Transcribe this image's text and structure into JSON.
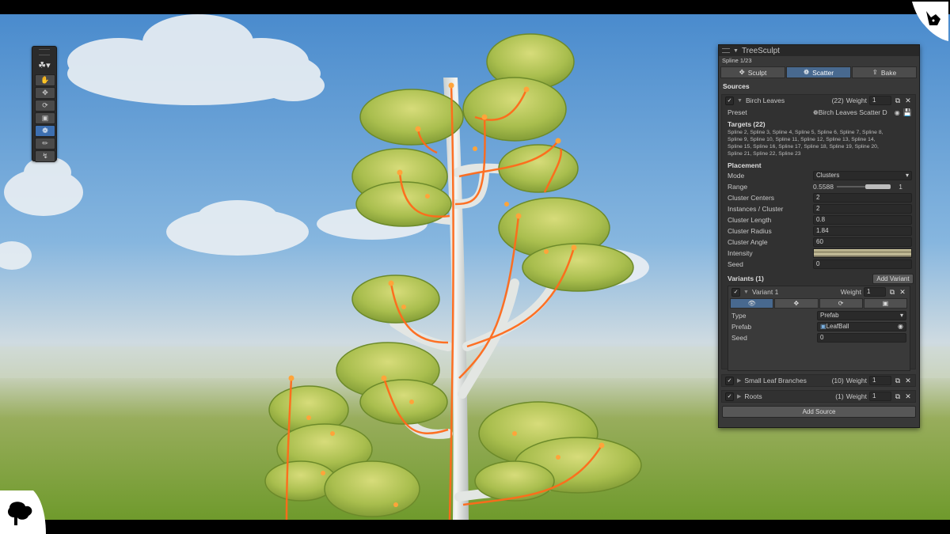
{
  "toolbar": {
    "tools": [
      {
        "icon": "hand-icon",
        "active": false
      },
      {
        "icon": "move-icon",
        "active": false
      },
      {
        "icon": "rotate-icon",
        "active": false
      },
      {
        "icon": "scale-icon",
        "active": false
      },
      {
        "icon": "scatter-icon",
        "active": true
      },
      {
        "icon": "brush-icon",
        "active": false
      },
      {
        "icon": "spline-icon",
        "active": false
      }
    ]
  },
  "panel": {
    "title": "TreeSculpt",
    "subtitle": "Spline 1/23",
    "tabs": [
      {
        "label": "Sculpt",
        "icon": "move-icon",
        "active": false
      },
      {
        "label": "Scatter",
        "icon": "scatter-icon",
        "active": true
      },
      {
        "label": "Bake",
        "icon": "export-icon",
        "active": false
      }
    ],
    "sources_heading": "Sources",
    "source1": {
      "name": "Birch Leaves",
      "count": "(22)",
      "weight_label": "Weight",
      "weight": "1",
      "preset_label": "Preset",
      "preset_value": "Birch Leaves Scatter D",
      "targets_heading": "Targets (22)",
      "targets_line1": "Spline 2,  Spline 3,  Spline 4,  Spline 5,  Spline 6,  Spline 7,  Spline 8,",
      "targets_line2": "Spline 9,  Spline 10,  Spline 11,  Spline 12,  Spline 13,  Spline 14,",
      "targets_line3": "Spline 15,  Spline 16,  Spline 17,  Spline 18,  Spline 19,  Spline 20,",
      "targets_line4": "Spline 21,  Spline 22,  Spline 23",
      "placement_heading": "Placement",
      "mode_label": "Mode",
      "mode_value": "Clusters",
      "range_label": "Range",
      "range_min": "0.5588",
      "range_max": "1",
      "cluster_centers_label": "Cluster Centers",
      "cluster_centers": "2",
      "instances_label": "Instances / Cluster",
      "instances": "2",
      "cluster_length_label": "Cluster Length",
      "cluster_length": "0.8",
      "cluster_radius_label": "Cluster Radius",
      "cluster_radius": "1.84",
      "cluster_angle_label": "Cluster Angle",
      "cluster_angle": "60",
      "intensity_label": "Intensity",
      "seed_label": "Seed",
      "seed": "0",
      "variants_heading": "Variants (1)",
      "add_variant": "Add Variant",
      "variant": {
        "name": "Variant 1",
        "weight_label": "Weight",
        "weight": "1",
        "type_label": "Type",
        "type_value": "Prefab",
        "prefab_label": "Prefab",
        "prefab_value": "LeafBall",
        "seed_label": "Seed",
        "seed": "0"
      }
    },
    "source2": {
      "name": "Small Leaf Branches",
      "count": "(10)",
      "weight_label": "Weight",
      "weight": "1"
    },
    "source3": {
      "name": "Roots",
      "count": "(1)",
      "weight_label": "Weight",
      "weight": "1"
    },
    "add_source": "Add Source"
  },
  "colors": {
    "accent_tab": "#48698f",
    "spline": "#ff6a1a",
    "sky_top": "#4d8fd0",
    "grass": "#7da23a"
  }
}
